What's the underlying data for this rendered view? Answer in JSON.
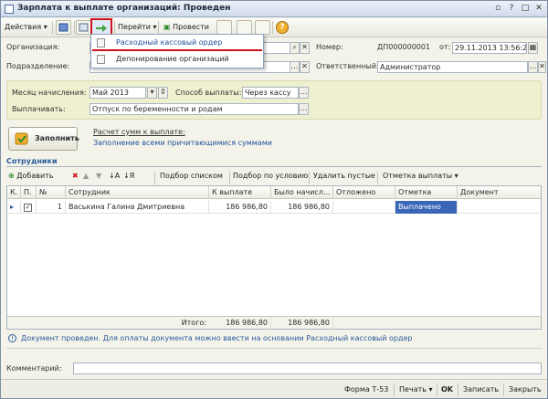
{
  "window": {
    "title": "Зарплата к выплате организаций: Проведен"
  },
  "toolbar": {
    "actions_label": "Действия",
    "goto_label": "Перейти",
    "post_label": "Провести"
  },
  "dropdown": {
    "items": [
      "Расходный кассовый ордер",
      "Депонирование организаций"
    ]
  },
  "form": {
    "org_label": "Организация:",
    "dept_label": "Подразделение:",
    "number_label": "Номер:",
    "number_value": "ДП000000001",
    "date_label": "от:",
    "date_value": "29.11.2013 13:56:29",
    "responsible_label": "Ответственный:",
    "responsible_value": "Администратор",
    "month_label": "Месяц начисления:",
    "month_value": "Май 2013",
    "payment_method_label": "Способ выплаты:",
    "payment_method_value": "Через кассу",
    "pay_label": "Выплачивать:",
    "pay_value": "Отпуск по беременности и родам"
  },
  "fill": {
    "button_label": "Заполнить",
    "calc_link": "Расчет сумм к выплате:",
    "fill_link": "Заполнение всеми причитающимися суммами"
  },
  "employees": {
    "section_label": "Сотрудники",
    "add_label": "Добавить",
    "select_list": "Подбор списком",
    "select_condition": "Подбор по условию",
    "delete_empty": "Удалить пустые",
    "mark_payment": "Отметка выплаты",
    "columns": [
      "К.",
      "П.",
      "№",
      "Сотрудник",
      "К выплате",
      "Было начисл...",
      "Отложено",
      "Отметка",
      "Документ"
    ],
    "rows": [
      {
        "num": "1",
        "employee": "Васькина Галина Дмитриевна",
        "to_pay": "186 986,80",
        "accrued": "186 986,80",
        "deferred": "",
        "mark": "Выплачено",
        "document": ""
      }
    ],
    "total_label": "Итого:",
    "total_to_pay": "186 986,80",
    "total_accrued": "186 986,80"
  },
  "info": {
    "message": "Документ проведен. Для оплаты документа можно ввести на основании Расходный кассовый ордер"
  },
  "comment": {
    "label": "Комментарий:",
    "value": ""
  },
  "bottom": {
    "form_name": "Форма Т-53",
    "print_label": "Печать",
    "ok_label": "OK",
    "save_label": "Записать",
    "close_label": "Закрыть"
  }
}
